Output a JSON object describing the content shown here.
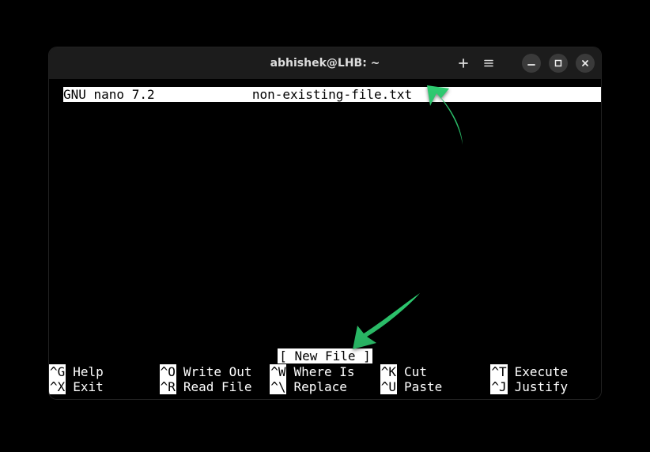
{
  "window": {
    "title": "abhishek@LHB: ~"
  },
  "nano": {
    "app_name": "GNU nano 7.2",
    "filename": "non-existing-file.txt",
    "status": "[ New File ]"
  },
  "shortcuts": {
    "row1": [
      {
        "key": "^G",
        "label": "Help"
      },
      {
        "key": "^O",
        "label": "Write Out"
      },
      {
        "key": "^W",
        "label": "Where Is"
      },
      {
        "key": "^K",
        "label": "Cut"
      },
      {
        "key": "^T",
        "label": "Execute"
      }
    ],
    "row2": [
      {
        "key": "^X",
        "label": "Exit"
      },
      {
        "key": "^R",
        "label": "Read File"
      },
      {
        "key": "^\\",
        "label": "Replace"
      },
      {
        "key": "^U",
        "label": "Paste"
      },
      {
        "key": "^J",
        "label": "Justify"
      }
    ]
  },
  "colors": {
    "arrow": "#2ecc71"
  }
}
